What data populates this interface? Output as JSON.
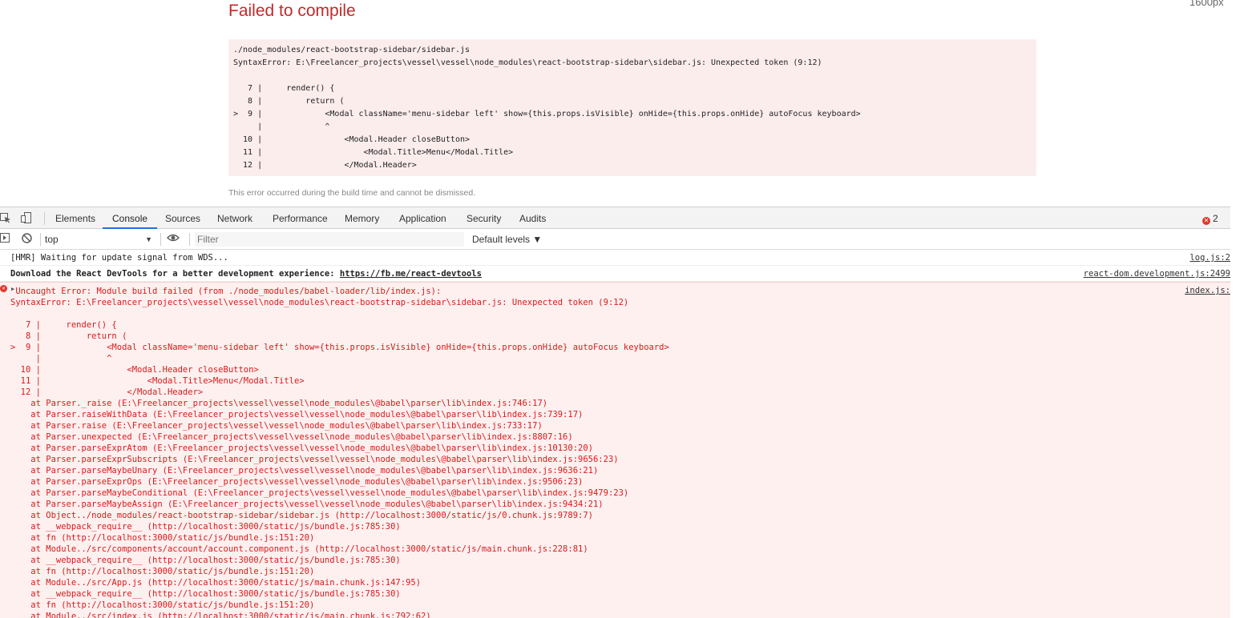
{
  "page": {
    "title": "Failed to compile",
    "width_indicator": "1600px",
    "error_box_lines": [
      "./node_modules/react-bootstrap-sidebar/sidebar.js",
      "SyntaxError: E:\\Freelancer_projects\\vessel\\vessel\\node_modules\\react-bootstrap-sidebar\\sidebar.js: Unexpected token (9:12)",
      "",
      "   7 |     render() {",
      "   8 |         return (",
      ">  9 |             <Modal className='menu-sidebar left' show={this.props.isVisible} onHide={this.props.onHide} autoFocus keyboard>",
      "     |             ^",
      "  10 |                 <Modal.Header closeButton>",
      "  11 |                     <Modal.Title>Menu</Modal.Title>",
      "  12 |                 </Modal.Header>"
    ],
    "note": "This error occurred during the build time and cannot be dismissed."
  },
  "devtools": {
    "tabs": [
      "Elements",
      "Console",
      "Sources",
      "Network",
      "Performance",
      "Memory",
      "Application",
      "Security",
      "Audits"
    ],
    "active_tab": "Console",
    "error_count": "2",
    "context": "top",
    "filter_placeholder": "Filter",
    "levels": "Default levels ▼",
    "messages": [
      {
        "text": "[HMR] Waiting for update signal from WDS...",
        "source": "log.js:2"
      },
      {
        "text": "Download the React DevTools for a better development experience: ",
        "link": "https://fb.me/react-devtools",
        "source": "react-dom.development.js:2499"
      }
    ],
    "error": {
      "source": "index.js:",
      "lines": [
        " Uncaught Error: Module build failed (from ./node_modules/babel-loader/lib/index.js):",
        "SyntaxError: E:\\Freelancer_projects\\vessel\\vessel\\node_modules\\react-bootstrap-sidebar\\sidebar.js: Unexpected token (9:12)",
        "",
        "   7 |     render() {",
        "   8 |         return (",
        ">  9 |             <Modal className='menu-sidebar left' show={this.props.isVisible} onHide={this.props.onHide} autoFocus keyboard>",
        "     |             ^",
        "  10 |                 <Modal.Header closeButton>",
        "  11 |                     <Modal.Title>Menu</Modal.Title>",
        "  12 |                 </Modal.Header>",
        "    at Parser._raise (E:\\Freelancer_projects\\vessel\\vessel\\node_modules\\@babel\\parser\\lib\\index.js:746:17)",
        "    at Parser.raiseWithData (E:\\Freelancer_projects\\vessel\\vessel\\node_modules\\@babel\\parser\\lib\\index.js:739:17)",
        "    at Parser.raise (E:\\Freelancer_projects\\vessel\\vessel\\node_modules\\@babel\\parser\\lib\\index.js:733:17)",
        "    at Parser.unexpected (E:\\Freelancer_projects\\vessel\\vessel\\node_modules\\@babel\\parser\\lib\\index.js:8807:16)",
        "    at Parser.parseExprAtom (E:\\Freelancer_projects\\vessel\\vessel\\node_modules\\@babel\\parser\\lib\\index.js:10130:20)",
        "    at Parser.parseExprSubscripts (E:\\Freelancer_projects\\vessel\\vessel\\node_modules\\@babel\\parser\\lib\\index.js:9656:23)",
        "    at Parser.parseMaybeUnary (E:\\Freelancer_projects\\vessel\\vessel\\node_modules\\@babel\\parser\\lib\\index.js:9636:21)",
        "    at Parser.parseExprOps (E:\\Freelancer_projects\\vessel\\vessel\\node_modules\\@babel\\parser\\lib\\index.js:9506:23)",
        "    at Parser.parseMaybeConditional (E:\\Freelancer_projects\\vessel\\vessel\\node_modules\\@babel\\parser\\lib\\index.js:9479:23)",
        "    at Parser.parseMaybeAssign (E:\\Freelancer_projects\\vessel\\vessel\\node_modules\\@babel\\parser\\lib\\index.js:9434:21)",
        "    at Object../node_modules/react-bootstrap-sidebar/sidebar.js (http://localhost:3000/static/js/0.chunk.js:9789:7)",
        "    at __webpack_require__ (http://localhost:3000/static/js/bundle.js:785:30)",
        "    at fn (http://localhost:3000/static/js/bundle.js:151:20)",
        "    at Module../src/components/account/account.component.js (http://localhost:3000/static/js/main.chunk.js:228:81)",
        "    at __webpack_require__ (http://localhost:3000/static/js/bundle.js:785:30)",
        "    at fn (http://localhost:3000/static/js/bundle.js:151:20)",
        "    at Module../src/App.js (http://localhost:3000/static/js/main.chunk.js:147:95)",
        "    at __webpack_require__ (http://localhost:3000/static/js/bundle.js:785:30)",
        "    at fn (http://localhost:3000/static/js/bundle.js:151:20)",
        "    at Module../src/index.js (http://localhost:3000/static/js/main.chunk.js:792:62)"
      ]
    }
  },
  "colors": {
    "error_red": "#c22a2a",
    "console_error_bg": "#fff0f0",
    "active_tab_underline": "#1a73e8"
  },
  "icons": [
    "inspect-icon",
    "device-toggle-icon",
    "sidebar-toggle-icon",
    "clear-console-icon",
    "eye-icon",
    "error-icon",
    "expand-triangle-icon"
  ]
}
